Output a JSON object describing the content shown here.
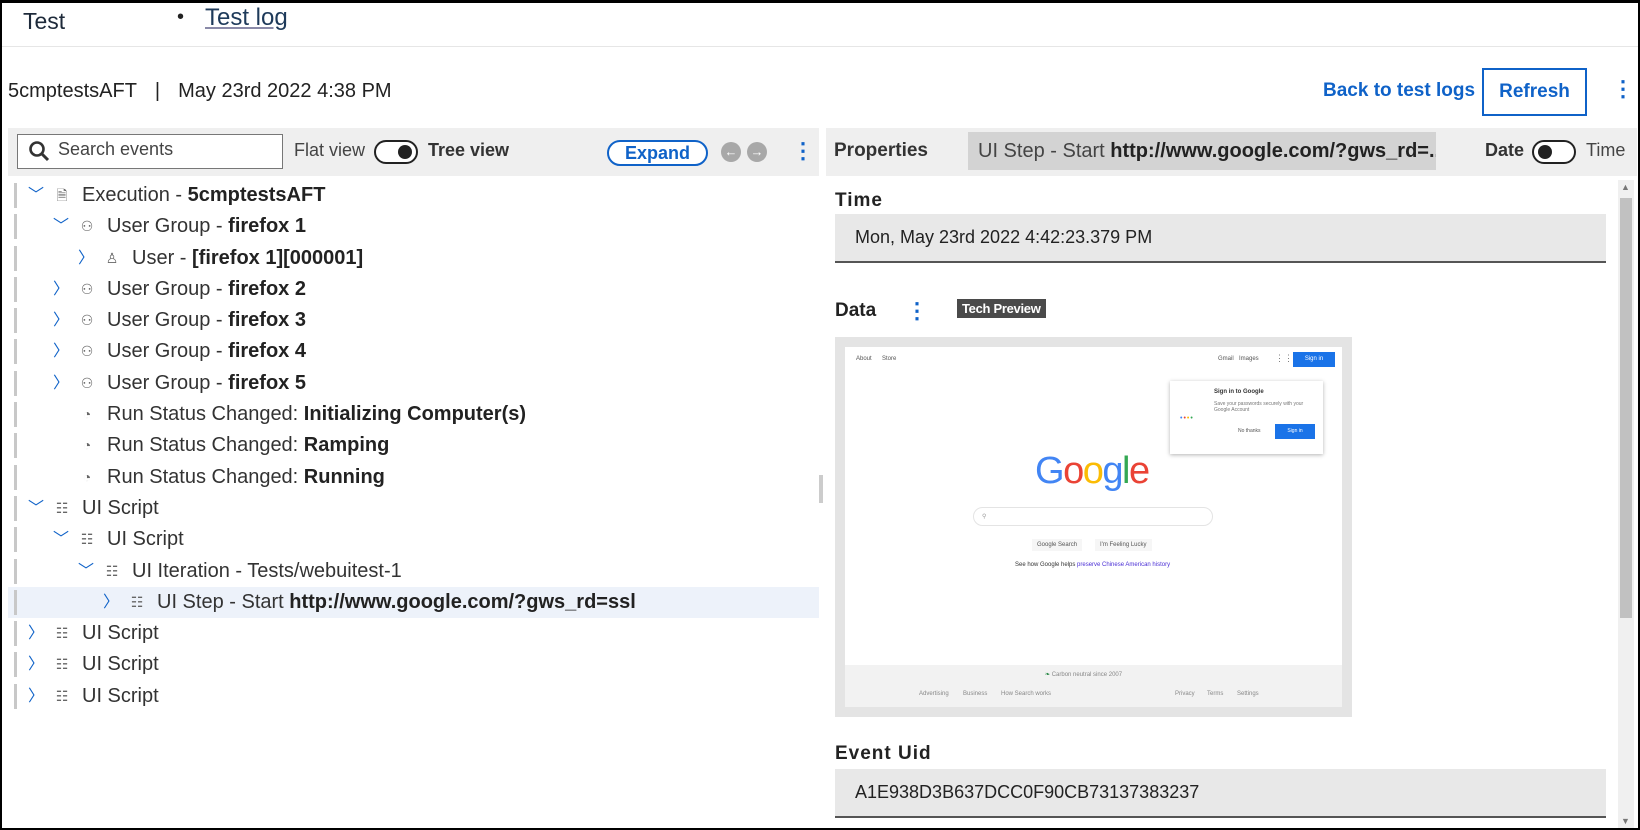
{
  "header": {
    "app_title": "Test",
    "breadcrumb": "Test log"
  },
  "subheader": {
    "test_name": "5cmptestsAFT",
    "separator": "|",
    "date": "May 23rd 2022 4:38 PM",
    "back_label": "Back to test logs",
    "refresh_label": "Refresh"
  },
  "left_toolbar": {
    "search_placeholder": "Search events",
    "flat_label": "Flat view",
    "tree_label": "Tree view",
    "view_mode": "tree",
    "expand_label": "Expand"
  },
  "tree": [
    {
      "level": 0,
      "chevron": "down",
      "icon": "document",
      "prefix": "Execution - ",
      "bold": "5cmptestsAFT"
    },
    {
      "level": 1,
      "chevron": "down",
      "icon": "user-group",
      "prefix": "User Group - ",
      "bold": "firefox 1"
    },
    {
      "level": 2,
      "chevron": "right",
      "icon": "user",
      "prefix": "User - ",
      "bold": "[firefox 1][000001]"
    },
    {
      "level": 1,
      "chevron": "right",
      "icon": "user-group",
      "prefix": "User Group - ",
      "bold": "firefox 2"
    },
    {
      "level": 1,
      "chevron": "right",
      "icon": "user-group",
      "prefix": "User Group - ",
      "bold": "firefox 3"
    },
    {
      "level": 1,
      "chevron": "right",
      "icon": "user-group",
      "prefix": "User Group - ",
      "bold": "firefox 4"
    },
    {
      "level": 1,
      "chevron": "right",
      "icon": "user-group",
      "prefix": "User Group - ",
      "bold": "firefox 5"
    },
    {
      "level": 1,
      "chevron": "none",
      "icon": "gauge",
      "prefix": "Run Status Changed: ",
      "bold": "Initializing Computer(s)"
    },
    {
      "level": 1,
      "chevron": "none",
      "icon": "gauge",
      "prefix": "Run Status Changed: ",
      "bold": "Ramping"
    },
    {
      "level": 1,
      "chevron": "none",
      "icon": "gauge",
      "prefix": "Run Status Changed: ",
      "bold": "Running"
    },
    {
      "level": 0,
      "chevron": "down",
      "icon": "ui-script",
      "prefix": "UI Script",
      "bold": ""
    },
    {
      "level": 1,
      "chevron": "down",
      "icon": "ui-script",
      "prefix": "UI Script",
      "bold": ""
    },
    {
      "level": 2,
      "chevron": "down",
      "icon": "ui-script",
      "prefix": "UI Iteration - Tests/webuitest-1",
      "bold": ""
    },
    {
      "level": 3,
      "chevron": "right",
      "icon": "ui-script",
      "prefix": "UI Step - Start ",
      "bold": "http://www.google.com/?gws_rd=ssl",
      "selected": true
    },
    {
      "level": 0,
      "chevron": "right",
      "icon": "ui-script",
      "prefix": "UI Script",
      "bold": ""
    },
    {
      "level": 0,
      "chevron": "right",
      "icon": "ui-script",
      "prefix": "UI Script",
      "bold": ""
    },
    {
      "level": 0,
      "chevron": "right",
      "icon": "ui-script",
      "prefix": "UI Script",
      "bold": ""
    }
  ],
  "properties": {
    "title": "Properties",
    "selected_prefix": "UI Step - Start ",
    "selected_bold": "http://www.google.com/?gws_rd=...",
    "date_label": "Date",
    "time_label": "Time",
    "date_time_mode": "date",
    "time_field_label": "Time",
    "time_value": "Mon, May 23rd 2022 4:42:23.379 PM",
    "data_label": "Data",
    "tech_preview": "Tech Preview",
    "event_uid_label": "Event Uid",
    "event_uid_value": "A1E938D3B637DCC0F90CB73137383237"
  },
  "screenshot": {
    "about": "About",
    "store": "Store",
    "gmail": "Gmail",
    "images": "Images",
    "sign_in": "Sign in",
    "popup_title": "Sign in to Google",
    "popup_text": "Save your passwords securely with your Google Account",
    "no_thanks": "No thanks",
    "popup_sign_in": "Sign in",
    "logo": "Google",
    "search_btn": "Google Search",
    "lucky_btn": "I'm Feeling Lucky",
    "promo": "See how Google helps ",
    "promo_link": "preserve Chinese American history",
    "carbon": "Carbon neutral since 2007",
    "footer_left": [
      "Advertising",
      "Business",
      "How Search works"
    ],
    "footer_right": [
      "Privacy",
      "Terms",
      "Settings"
    ]
  },
  "colors": {
    "accent": "#0f62c8",
    "selected_row": "#edf2fa",
    "toolbar_bg": "#efefef"
  }
}
